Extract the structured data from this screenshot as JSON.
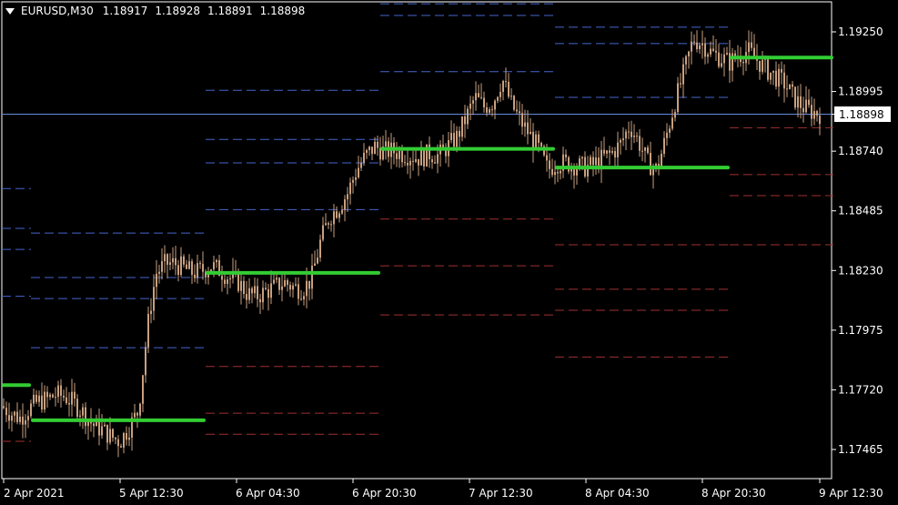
{
  "header": {
    "symbol": "EURUSD,M30",
    "open": "1.18917",
    "high": "1.18928",
    "low": "1.18891",
    "close": "1.18898"
  },
  "current_price_label": "1.18898",
  "colors": {
    "background": "#000000",
    "axis": "#ffffff",
    "candle": "#c8a080",
    "pivot": "#33cc33",
    "resistance": "#4466cc",
    "support": "#a03030",
    "current_price_line": "#6688dd"
  },
  "chart_data": {
    "type": "candlestick",
    "title": "EURUSD,M30",
    "xlabel": "",
    "ylabel": "",
    "ylim": [
      1.1725,
      1.194
    ],
    "grid": false,
    "yticks": [
      "1.19250",
      "1.18995",
      "1.18740",
      "1.18485",
      "1.18230",
      "1.17975",
      "1.17720",
      "1.17465"
    ],
    "xticks": [
      "2 Apr 2021",
      "5 Apr 12:30",
      "6 Apr 04:30",
      "6 Apr 20:30",
      "7 Apr 12:30",
      "8 Apr 04:30",
      "8 Apr 20:30",
      "9 Apr 12:30"
    ],
    "current_price": 1.18898,
    "price_path": [
      [
        0,
        1.1765
      ],
      [
        10,
        1.1762
      ],
      [
        20,
        1.176
      ],
      [
        30,
        1.1764
      ],
      [
        40,
        1.1767
      ],
      [
        50,
        1.1768
      ],
      [
        60,
        1.177
      ],
      [
        70,
        1.1769
      ],
      [
        80,
        1.1766
      ],
      [
        90,
        1.1762
      ],
      [
        100,
        1.1757
      ],
      [
        110,
        1.1755
      ],
      [
        120,
        1.1752
      ],
      [
        130,
        1.175
      ],
      [
        140,
        1.1756
      ],
      [
        150,
        1.1763
      ],
      [
        155,
        1.178
      ],
      [
        160,
        1.1798
      ],
      [
        165,
        1.1812
      ],
      [
        170,
        1.1822
      ],
      [
        180,
        1.1826
      ],
      [
        190,
        1.1826
      ],
      [
        200,
        1.1824
      ],
      [
        210,
        1.1822
      ],
      [
        220,
        1.1823
      ],
      [
        230,
        1.1825
      ],
      [
        240,
        1.1823
      ],
      [
        250,
        1.182
      ],
      [
        260,
        1.1818
      ],
      [
        270,
        1.1813
      ],
      [
        280,
        1.1812
      ],
      [
        290,
        1.1814
      ],
      [
        300,
        1.1816
      ],
      [
        310,
        1.1818
      ],
      [
        320,
        1.1816
      ],
      [
        330,
        1.1815
      ],
      [
        340,
        1.1819
      ],
      [
        350,
        1.1835
      ],
      [
        360,
        1.1846
      ],
      [
        370,
        1.185
      ],
      [
        380,
        1.1856
      ],
      [
        390,
        1.1866
      ],
      [
        400,
        1.1872
      ],
      [
        410,
        1.1876
      ],
      [
        420,
        1.1874
      ],
      [
        430,
        1.1874
      ],
      [
        440,
        1.1873
      ],
      [
        450,
        1.1872
      ],
      [
        460,
        1.1871
      ],
      [
        470,
        1.1873
      ],
      [
        480,
        1.1872
      ],
      [
        490,
        1.1876
      ],
      [
        500,
        1.188
      ],
      [
        510,
        1.1888
      ],
      [
        520,
        1.1897
      ],
      [
        530,
        1.1893
      ],
      [
        540,
        1.1895
      ],
      [
        550,
        1.1905
      ],
      [
        560,
        1.1894
      ],
      [
        570,
        1.1887
      ],
      [
        580,
        1.1881
      ],
      [
        590,
        1.1875
      ],
      [
        600,
        1.1866
      ],
      [
        610,
        1.1869
      ],
      [
        620,
        1.1869
      ],
      [
        630,
        1.1868
      ],
      [
        640,
        1.1867
      ],
      [
        650,
        1.1868
      ],
      [
        660,
        1.1871
      ],
      [
        670,
        1.1873
      ],
      [
        680,
        1.1877
      ],
      [
        690,
        1.1885
      ],
      [
        700,
        1.1878
      ],
      [
        710,
        1.1869
      ],
      [
        720,
        1.1866
      ],
      [
        730,
        1.188
      ],
      [
        740,
        1.1895
      ],
      [
        750,
        1.1908
      ],
      [
        760,
        1.1922
      ],
      [
        770,
        1.192
      ],
      [
        780,
        1.1916
      ],
      [
        790,
        1.1914
      ],
      [
        800,
        1.1912
      ],
      [
        810,
        1.1915
      ],
      [
        820,
        1.1917
      ],
      [
        830,
        1.1913
      ],
      [
        840,
        1.1909
      ],
      [
        850,
        1.1906
      ],
      [
        860,
        1.1903
      ],
      [
        870,
        1.1897
      ],
      [
        880,
        1.1893
      ],
      [
        890,
        1.1891
      ],
      [
        900,
        1.189
      ]
    ],
    "pivot_segments": [
      {
        "x0": 0,
        "x1": 32,
        "value": 1.1774
      },
      {
        "x0": 32,
        "x1": 224,
        "value": 1.1759
      },
      {
        "x0": 224,
        "x1": 416,
        "value": 1.1822
      },
      {
        "x0": 416,
        "x1": 608,
        "value": 1.1875
      },
      {
        "x0": 608,
        "x1": 800,
        "value": 1.1867
      },
      {
        "x0": 800,
        "x1": 914,
        "value": 1.1914
      }
    ],
    "resistance_segments": [
      {
        "x0": 0,
        "x1": 32,
        "values": [
          1.1812,
          1.1832,
          1.1841,
          1.1858
        ]
      },
      {
        "x0": 32,
        "x1": 224,
        "values": [
          1.179,
          1.1811,
          1.182,
          1.1839
        ]
      },
      {
        "x0": 224,
        "x1": 416,
        "values": [
          1.1849,
          1.1869,
          1.1879,
          1.19
        ]
      },
      {
        "x0": 416,
        "x1": 608,
        "values": [
          1.1908,
          1.1932,
          1.1937
        ]
      },
      {
        "x0": 608,
        "x1": 800,
        "values": [
          1.1897,
          1.192,
          1.1927
        ]
      }
    ],
    "support_segments": [
      {
        "x0": 0,
        "x1": 32,
        "values": [
          1.175
        ]
      },
      {
        "x0": 32,
        "x1": 224,
        "values": []
      },
      {
        "x0": 224,
        "x1": 416,
        "values": [
          1.1782,
          1.1762,
          1.1753
        ]
      },
      {
        "x0": 416,
        "x1": 608,
        "values": [
          1.1845,
          1.1825,
          1.1804
        ]
      },
      {
        "x0": 608,
        "x1": 800,
        "values": [
          1.1834,
          1.1815,
          1.1806,
          1.1786
        ]
      },
      {
        "x0": 800,
        "x1": 914,
        "values": [
          1.1884,
          1.1864,
          1.1855,
          1.1834
        ]
      }
    ]
  }
}
